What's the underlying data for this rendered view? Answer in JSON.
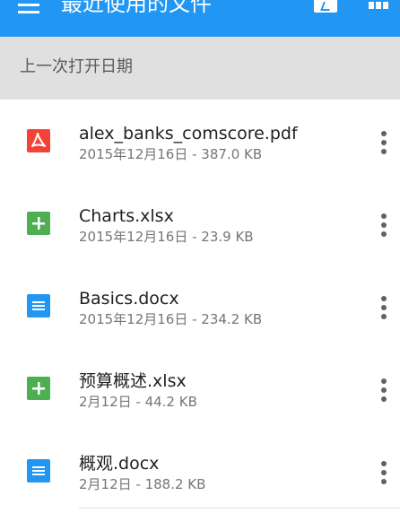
{
  "appbar": {
    "title": "最近使用的文件",
    "menu_icon": "hamburger-menu-icon",
    "action_icons": [
      "reader-icon",
      "grid-view-icon"
    ],
    "color": "#2196F3"
  },
  "section": {
    "header": "上一次打开日期"
  },
  "files": [
    {
      "name": "alex_banks_comscore.pdf",
      "meta": "2015年12月16日 - 387.0 KB",
      "type": "pdf",
      "icon": "pdf-file-icon",
      "color": "#F44336"
    },
    {
      "name": "Charts.xlsx",
      "meta": "2015年12月16日 - 23.9 KB",
      "type": "sheet",
      "icon": "spreadsheet-file-icon",
      "color": "#4CAF50"
    },
    {
      "name": "Basics.docx",
      "meta": "2015年12月16日 - 234.2 KB",
      "type": "doc",
      "icon": "document-file-icon",
      "color": "#2196F3"
    },
    {
      "name": "预算概述.xlsx",
      "meta": "2月12日 - 44.2 KB",
      "type": "sheet",
      "icon": "spreadsheet-file-icon",
      "color": "#4CAF50"
    },
    {
      "name": "概观.docx",
      "meta": "2月12日 - 188.2 KB",
      "type": "doc",
      "icon": "document-file-icon",
      "color": "#2196F3"
    }
  ]
}
